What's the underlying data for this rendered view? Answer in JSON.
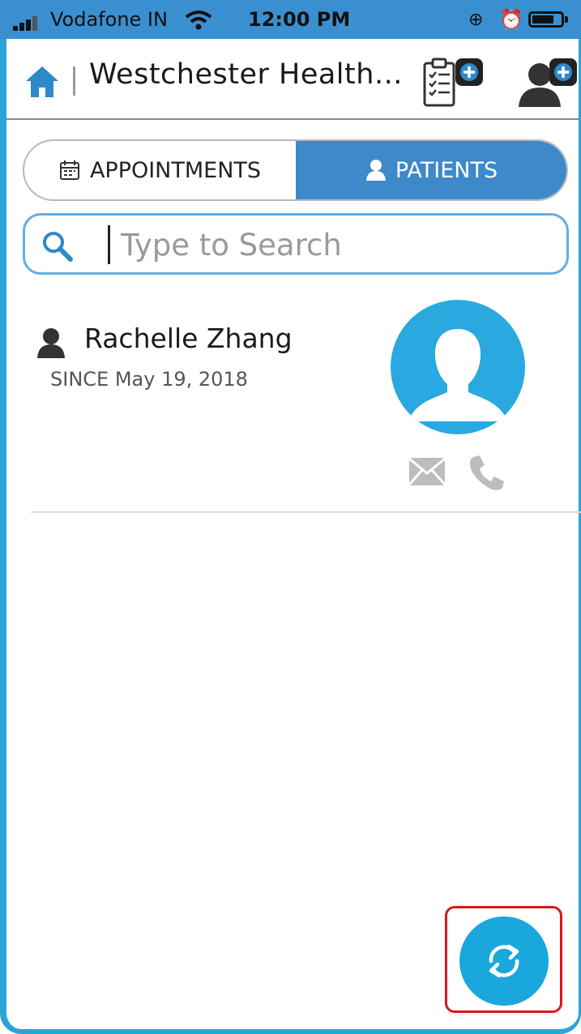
{
  "status_bar": {
    "carrier": "Vodafone IN",
    "time": "12:00 PM"
  },
  "header": {
    "title": "Westchester Health..."
  },
  "tabs": [
    {
      "label": "APPOINTMENTS",
      "active": false
    },
    {
      "label": "PATIENTS",
      "active": true
    }
  ],
  "search": {
    "placeholder": "Type to Search",
    "value": ""
  },
  "patients": [
    {
      "name": "Rachelle Zhang",
      "since": "SINCE May 19, 2018"
    }
  ],
  "colors": {
    "accent": "#3d89c9",
    "fab": "#1aa7dc",
    "highlight": "#e0141b"
  }
}
